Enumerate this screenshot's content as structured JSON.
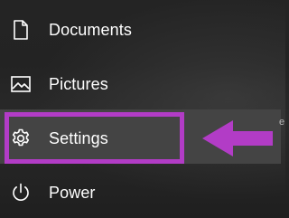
{
  "menu": {
    "items": [
      {
        "label": "Documents",
        "icon": "document-icon"
      },
      {
        "label": "Pictures",
        "icon": "pictures-icon"
      },
      {
        "label": "Settings",
        "icon": "gear-icon"
      },
      {
        "label": "Power",
        "icon": "power-icon"
      }
    ]
  },
  "annotation": {
    "highlight_color": "#b23cc6",
    "arrow_color": "#b23cc6",
    "arrow_direction": "left",
    "edge_glyph": "e"
  },
  "colors": {
    "background": "#242424",
    "hover": "#444444",
    "text": "#ffffff"
  }
}
